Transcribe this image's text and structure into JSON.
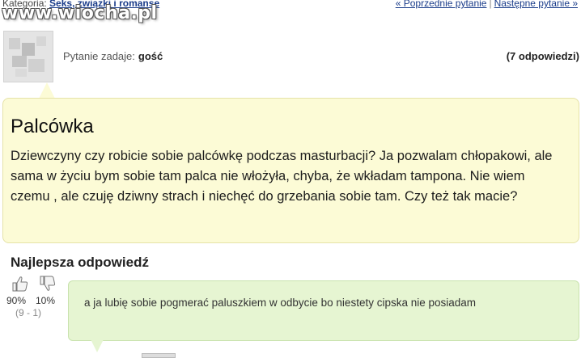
{
  "header": {
    "category_label": "Kategoria:",
    "category_link": "Seks, związki i romanse",
    "prev_question": "« Poprzednie pytanie",
    "separator": "|",
    "next_question": "Następne pytanie »",
    "watermark": "www.wiocha.pl"
  },
  "question": {
    "asker_label": "Pytanie zadaje:",
    "asker_name": "gość",
    "answer_count": "(7 odpowiedzi)",
    "title": "Palcówka",
    "body": "Dziewczyny czy robicie sobie palcówkę podczas masturbacji? Ja pozwalam chłopakowi, ale sama w życiu bym sobie tam palca nie włożyła, chyba, że wkładam tampona. Nie wiem czemu , ale czuję dziwny strach i niechęć do grzebania sobie tam. Czy też tak macie?"
  },
  "best_answer": {
    "heading": "Najlepsza odpowiedź",
    "up_percent": "90%",
    "down_percent": "10%",
    "votes": "(9 - 1)",
    "text": "a ja lubię sobie pogmerać paluszkiem w odbycie bo niestety cipska nie posiadam"
  },
  "icons": {
    "thumb_up": "thumb-up-icon",
    "thumb_down": "thumb-down-icon",
    "avatar": "blurred-avatar"
  },
  "colors": {
    "question_bubble": "#fcfbd6",
    "answer_bubble": "#e6f5d2",
    "link": "#1a3c8a"
  }
}
